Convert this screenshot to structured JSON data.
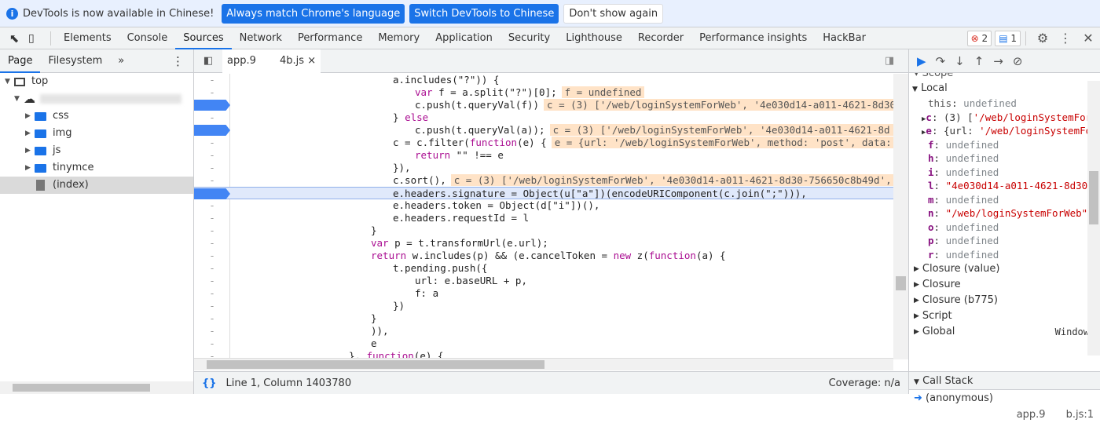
{
  "infobar": {
    "message": "DevTools is now available in Chinese!",
    "btn_match": "Always match Chrome's language",
    "btn_switch": "Switch DevTools to Chinese",
    "btn_dismiss": "Don't show again"
  },
  "tabs": [
    "Elements",
    "Console",
    "Sources",
    "Network",
    "Performance",
    "Memory",
    "Application",
    "Security",
    "Lighthouse",
    "Recorder",
    "Performance insights",
    "HackBar"
  ],
  "active_tab": "Sources",
  "errors": "2",
  "messages": "1",
  "left": {
    "tabs": [
      "Page",
      "Filesystem"
    ],
    "more": "»",
    "tree": {
      "top": "top",
      "folders": [
        "css",
        "img",
        "js",
        "tinymce"
      ],
      "file": "(index)"
    }
  },
  "editor": {
    "file_tab": "app.9   4b.js",
    "close": "×",
    "lines": [
      {
        "i": 7,
        "t": "a.includes(\"?\")) {"
      },
      {
        "i": 8,
        "t": "var f = a.split(\"?\")[0];",
        "a": "f = undefined"
      },
      {
        "i": 8,
        "t": "c.push(t.queryVal(f))",
        "a": "c = (3) ['/web/loginSystemForWeb', '4e030d14-a011-4621-8d30",
        "bp": true
      },
      {
        "i": 7,
        "t": "} else"
      },
      {
        "i": 8,
        "t": "c.push(t.queryVal(a));",
        "a": "c = (3) ['/web/loginSystemForWeb', '4e030d14-a011-4621-8d",
        "bp": true
      },
      {
        "i": 7,
        "t": "c = c.filter(function(e) {",
        "a": "e = {url: '/web/loginSystemForWeb', method: 'post', data: {…"
      },
      {
        "i": 8,
        "t": "return \"\" !== e"
      },
      {
        "i": 7,
        "t": "}),"
      },
      {
        "i": 7,
        "t": "c.sort(),",
        "a": "c = (3) ['/web/loginSystemForWeb', '4e030d14-a011-4621-8d30-756650c8b49d', '{"
      },
      {
        "i": 7,
        "t": "e.headers.signature = Object(u[\"a\"])(encodeURIComponent(c.join(\";\"))),",
        "bp": true,
        "hl": true
      },
      {
        "i": 7,
        "t": "e.headers.token = Object(d[\"i\"])(),"
      },
      {
        "i": 7,
        "t": "e.headers.requestId = l"
      },
      {
        "i": 6,
        "t": "}"
      },
      {
        "i": 6,
        "t": "var p = t.transformUrl(e.url);"
      },
      {
        "i": 6,
        "t": "return w.includes(p) && (e.cancelToken = new z(function(a) {"
      },
      {
        "i": 7,
        "t": "t.pending.push({"
      },
      {
        "i": 8,
        "t": "url: e.baseURL + p,"
      },
      {
        "i": 8,
        "t": "f: a"
      },
      {
        "i": 7,
        "t": "})"
      },
      {
        "i": 6,
        "t": "}"
      },
      {
        "i": 6,
        "t": ")),"
      },
      {
        "i": 6,
        "t": "e"
      },
      {
        "i": 5,
        "t": "}, function(e) {"
      }
    ],
    "gutter_mark": "-",
    "status": "Line 1, Column 1403780",
    "coverage": "Coverage: n/a"
  },
  "scope": {
    "header": "Scope",
    "local": "Local",
    "rows": [
      {
        "k": "this",
        "v": "undefined",
        "ty": "u",
        "exp": false,
        "plain": true
      },
      {
        "k": "c",
        "v": "(3) ['/web/loginSystemFor",
        "ty": "o",
        "exp": true
      },
      {
        "k": "e",
        "v": "{url: '/web/loginSystemFo",
        "ty": "o",
        "exp": true
      },
      {
        "k": "f",
        "v": "undefined",
        "ty": "u"
      },
      {
        "k": "h",
        "v": "undefined",
        "ty": "u"
      },
      {
        "k": "i",
        "v": "undefined",
        "ty": "u"
      },
      {
        "k": "l",
        "v": "\"4e030d14-a011-4621-8d30-",
        "ty": "s"
      },
      {
        "k": "m",
        "v": "undefined",
        "ty": "u"
      },
      {
        "k": "n",
        "v": "\"/web/loginSystemForWeb\"",
        "ty": "s"
      },
      {
        "k": "o",
        "v": "undefined",
        "ty": "u"
      },
      {
        "k": "p",
        "v": "undefined",
        "ty": "u"
      },
      {
        "k": "r",
        "v": "undefined",
        "ty": "u"
      }
    ],
    "sections": [
      "Closure (value)",
      "Closure",
      "Closure (b775)",
      "Script",
      "Global"
    ],
    "global_value": "Window",
    "callstack": "Call Stack",
    "frame": "(anonymous)",
    "frame_loc": "app.9  b.js:1"
  }
}
